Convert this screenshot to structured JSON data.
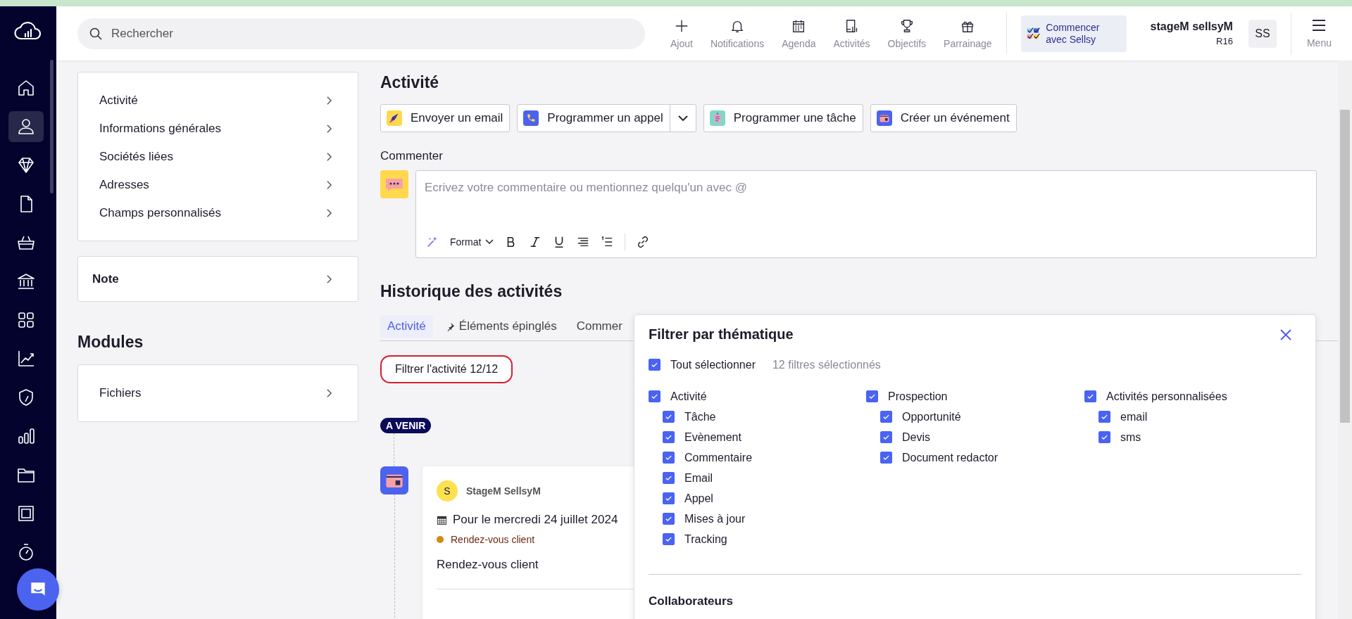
{
  "top_bar": {
    "search": {
      "placeholder": "Rechercher"
    },
    "actions": [
      {
        "kind": "add",
        "label": "Ajout"
      },
      {
        "kind": "notifications",
        "label": "Notifications"
      },
      {
        "kind": "agenda",
        "label": "Agenda"
      },
      {
        "kind": "activities",
        "label": "Activités"
      },
      {
        "kind": "goals",
        "label": "Objectifs"
      },
      {
        "kind": "referral",
        "label": "Parrainage"
      }
    ],
    "onboarding": "Commencer avec Sellsy",
    "user": {
      "name": "stageM sellsyM",
      "code": "R16",
      "initials": "SS"
    },
    "menu": "Menu"
  },
  "sidebar": {
    "items": [
      {
        "kind": "home",
        "selected": false
      },
      {
        "kind": "contacts",
        "selected": true
      },
      {
        "kind": "deals",
        "selected": false
      },
      {
        "kind": "documents",
        "selected": false
      },
      {
        "kind": "shop",
        "selected": false
      },
      {
        "kind": "bank",
        "selected": false
      },
      {
        "kind": "apps",
        "selected": false
      },
      {
        "kind": "stats",
        "selected": false
      },
      {
        "kind": "security",
        "selected": false
      },
      {
        "kind": "reports",
        "selected": false
      },
      {
        "kind": "files",
        "selected": false
      },
      {
        "kind": "stamps",
        "selected": false
      },
      {
        "kind": "time",
        "selected": false
      }
    ]
  },
  "left_panel": {
    "sections": [
      "Activité",
      "Informations générales",
      "Sociétés liées",
      "Adresses",
      "Champs personnalisés"
    ],
    "note": "Note",
    "modules_title": "Modules",
    "modules": [
      "Fichiers"
    ]
  },
  "activity": {
    "title": "Activité",
    "actions": [
      {
        "kind": "email",
        "label": "Envoyer un email",
        "split": false
      },
      {
        "kind": "call",
        "label": "Programmer un appel",
        "split": true
      },
      {
        "kind": "task",
        "label": "Programmer une tâche",
        "split": false
      },
      {
        "kind": "event",
        "label": "Créer un événement",
        "split": false
      }
    ],
    "comment": {
      "label": "Commenter",
      "placeholder": "Ecrivez votre commentaire ou mentionnez quelqu'un avec @",
      "format": "Format"
    }
  },
  "history": {
    "title": "Historique des activités",
    "tabs": [
      {
        "label": "Activité",
        "selected": true,
        "pinned": false
      },
      {
        "label": "Éléments épinglés",
        "selected": false,
        "pinned": true
      },
      {
        "label": "Commer",
        "selected": false,
        "pinned": false
      }
    ],
    "filter_button": {
      "label": "Filtrer l'activité 12/12",
      "focused": true
    },
    "badge": "A VENIR",
    "events": [
      {
        "kind": "event",
        "initial": "S",
        "author": "StageM SellsyM",
        "date": "Pour le mercredi 24 juillet 2024",
        "tag": {
          "label": "Rendez-vous client",
          "color": "#d08c0a"
        },
        "text": "Rendez-vous client"
      }
    ]
  },
  "filter_popup": {
    "title": "Filtrer par thématique",
    "select_all": {
      "label": "Tout sélectionner",
      "checked": true
    },
    "count": "12 filtres sélectionnés",
    "groups": [
      {
        "label": "Activité",
        "checked": true,
        "children": [
          {
            "label": "Tâche",
            "checked": true
          },
          {
            "label": "Evènement",
            "checked": true
          },
          {
            "label": "Commentaire",
            "checked": true
          },
          {
            "label": "Email",
            "checked": true
          },
          {
            "label": "Appel",
            "checked": true
          },
          {
            "label": "Mises à jour",
            "checked": true
          },
          {
            "label": "Tracking",
            "checked": true
          }
        ]
      },
      {
        "label": "Prospection",
        "checked": true,
        "children": [
          {
            "label": "Opportunité",
            "checked": true
          },
          {
            "label": "Devis",
            "checked": true
          },
          {
            "label": "Document redactor",
            "checked": true
          }
        ]
      },
      {
        "label": "Activités personnalisées",
        "checked": true,
        "children": [
          {
            "label": "email",
            "checked": true
          },
          {
            "label": "sms",
            "checked": true
          }
        ]
      }
    ],
    "section": "Collaborateurs"
  }
}
